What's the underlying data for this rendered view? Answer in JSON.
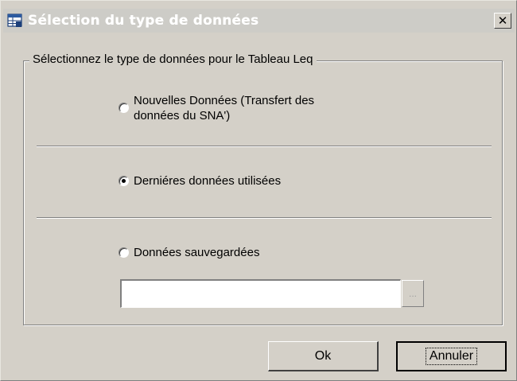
{
  "window": {
    "title": "Sélection du type de données",
    "icon": "data-table-icon",
    "close_label": "✕"
  },
  "group": {
    "legend": "Sélectionnez le type de données pour le Tableau Leq"
  },
  "options": [
    {
      "label_line1": "Nouvelles Données  (Transfert des",
      "label_line2": "données du SNA')",
      "checked": false
    },
    {
      "label": "Derniéres données utilisées",
      "checked": true
    },
    {
      "label": "Données sauvegardées",
      "checked": false
    }
  ],
  "saved_data": {
    "value": "",
    "browse_label": "..."
  },
  "buttons": {
    "ok": "Ok",
    "cancel": "Annuler"
  }
}
